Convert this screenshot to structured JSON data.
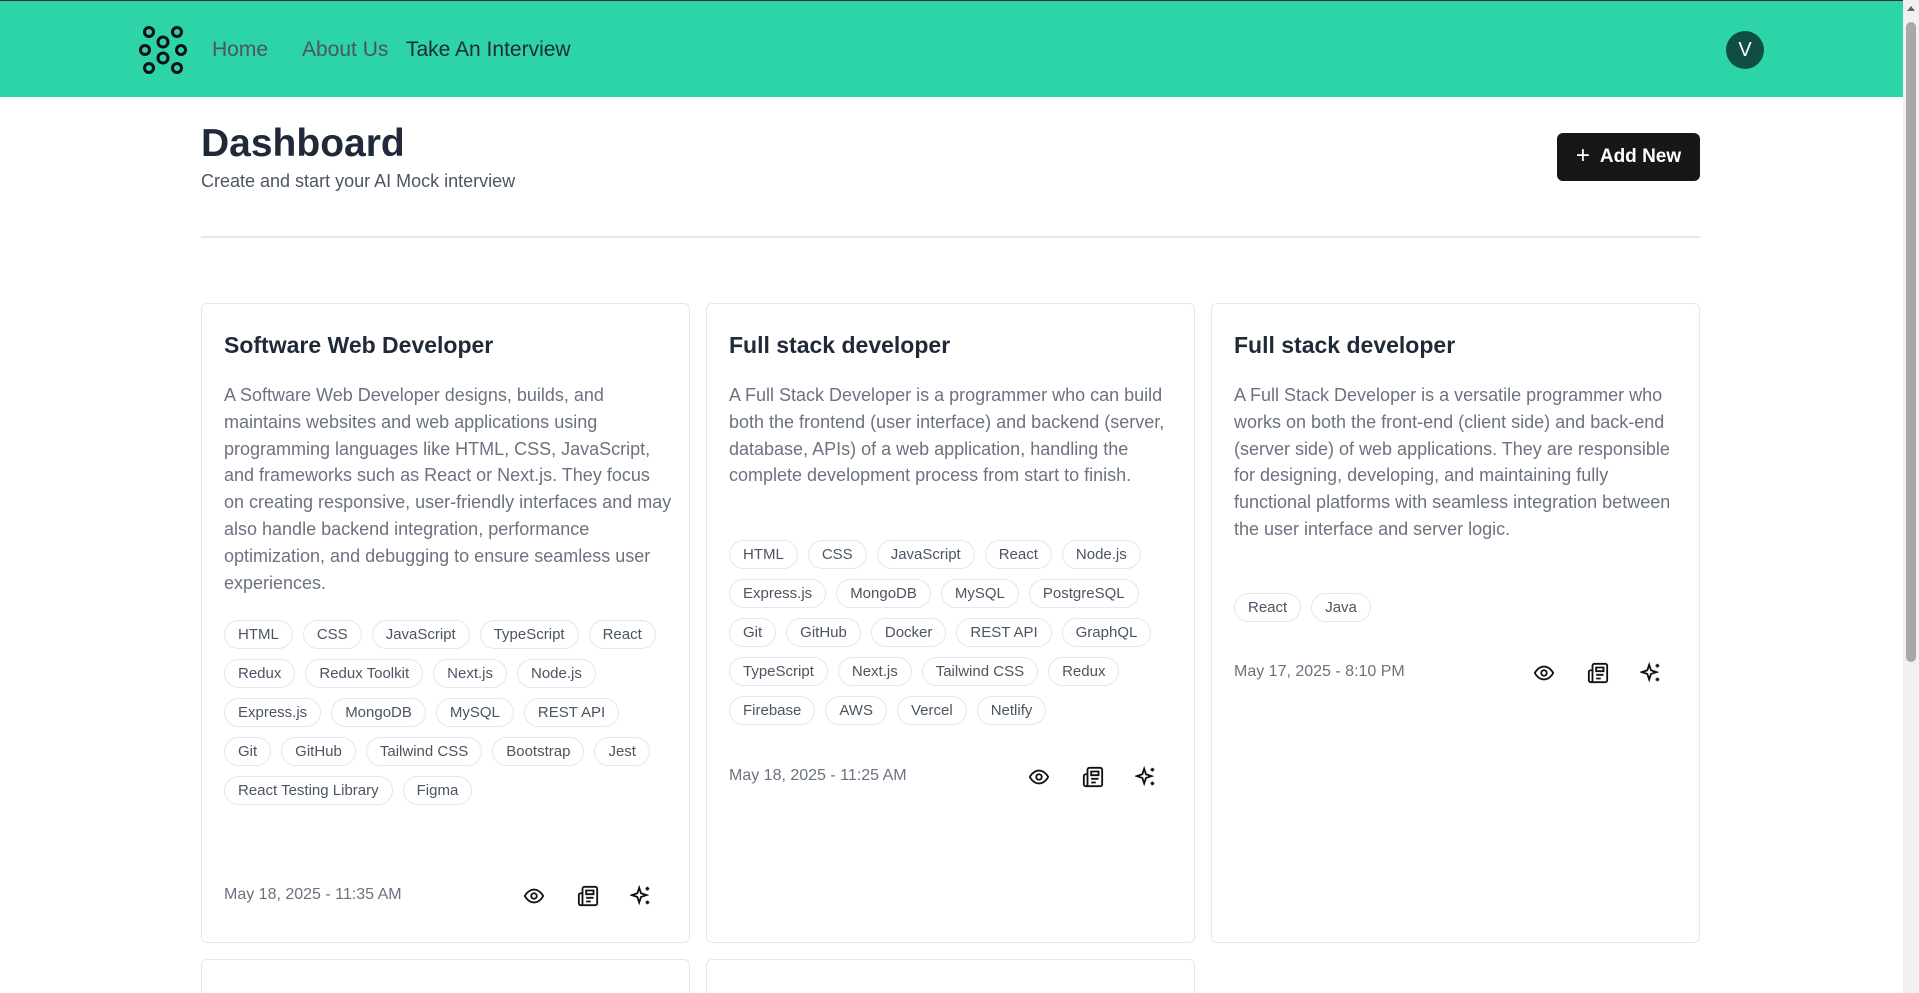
{
  "nav": {
    "home": "Home",
    "about": "About Us",
    "take_interview": "Take An Interview"
  },
  "user": {
    "avatar_initial": "V"
  },
  "dashboard": {
    "title": "Dashboard",
    "subtitle": "Create and start your AI Mock interview",
    "add_button": "Add New"
  },
  "cards": [
    {
      "title": "Software Web Developer",
      "description": "A Software Web Developer designs, builds, and maintains websites and web applications using programming languages like HTML, CSS, JavaScript, and frameworks such as React or Next.js. They focus on creating responsive, user-friendly interfaces and may also handle backend integration, performance optimization, and debugging to ensure seamless user experiences.",
      "tags": [
        "HTML",
        "CSS",
        "JavaScript",
        "TypeScript",
        "React",
        "Redux",
        "Redux Toolkit",
        "Next.js",
        "Node.js",
        "Express.js",
        "MongoDB",
        "MySQL",
        "REST API",
        "Git",
        "GitHub",
        "Tailwind CSS",
        "Bootstrap",
        "Jest",
        "React Testing Library",
        "Figma"
      ],
      "date": "May 18, 2025 - 11:35 AM"
    },
    {
      "title": "Full stack developer",
      "description": "A Full Stack Developer is a programmer who can build both the frontend (user interface) and backend (server, database, APIs) of a web application, handling the complete development process from start to finish.",
      "tags": [
        "HTML",
        "CSS",
        "JavaScript",
        "React",
        "Node.js",
        "Express.js",
        "MongoDB",
        "MySQL",
        "PostgreSQL",
        "Git",
        "GitHub",
        "Docker",
        "REST API",
        "GraphQL",
        "TypeScript",
        "Next.js",
        "Tailwind CSS",
        "Redux",
        "Firebase",
        "AWS",
        "Vercel",
        "Netlify"
      ],
      "date": "May 18, 2025 - 11:25 AM"
    },
    {
      "title": "Full stack developer",
      "description": "A Full Stack Developer is a versatile programmer who works on both the front-end (client side) and back-end (server side) of web applications. They are responsible for designing, developing, and maintaining fully functional platforms with seamless integration between the user interface and server logic.",
      "tags": [
        "React",
        "Java"
      ],
      "date": "May 17, 2025 - 8:10 PM"
    }
  ],
  "icons": {
    "logo": "flower-logo-icon",
    "view": "eye-icon",
    "report": "newspaper-icon",
    "ai": "sparkles-icon",
    "add": "plus-icon"
  },
  "colors": {
    "header_bg": "#2dd4a7",
    "avatar_bg": "#0f4f43",
    "button_bg": "#171717"
  }
}
